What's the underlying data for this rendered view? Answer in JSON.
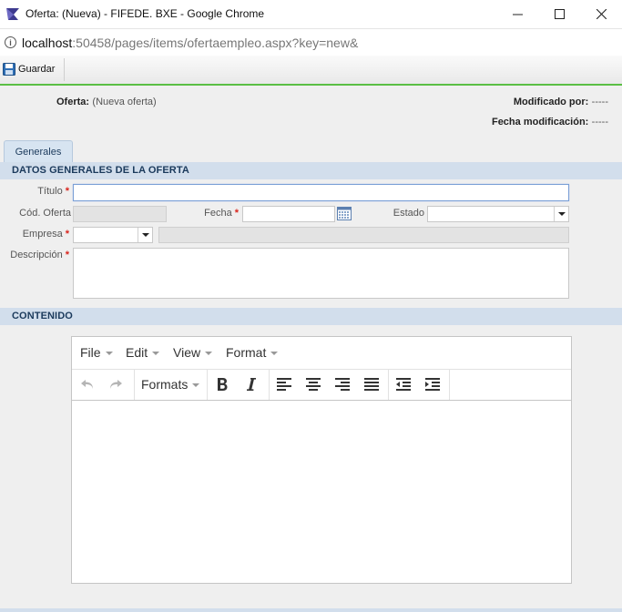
{
  "window": {
    "title": "Oferta: (Nueva) - FIFEDE. BXE - Google Chrome",
    "url_host": "localhost",
    "url_path": ":50458/pages/items/ofertaempleo.aspx?key=new&"
  },
  "toolbar": {
    "save_label": "Guardar"
  },
  "header": {
    "oferta_label": "Oferta:",
    "oferta_value": "(Nueva oferta)",
    "modificado_label": "Modificado por:",
    "modificado_value": "-----",
    "fecha_mod_label": "Fecha modificación:",
    "fecha_mod_value": "-----"
  },
  "tabs": [
    {
      "label": "Generales",
      "active": true
    }
  ],
  "sections": {
    "general": "DATOS GENERALES DE LA OFERTA",
    "content": "CONTENIDO"
  },
  "form": {
    "titulo_label": "Título",
    "cod_label": "Cód. Oferta",
    "fecha_label": "Fecha",
    "estado_label": "Estado",
    "empresa_label": "Empresa",
    "descripcion_label": "Descripción",
    "required_mark": "*"
  },
  "editor": {
    "menus": [
      "File",
      "Edit",
      "View",
      "Format"
    ],
    "formats_label": "Formats",
    "icons": [
      "undo-icon",
      "redo-icon",
      "bold-icon",
      "italic-icon",
      "align-left-icon",
      "align-center-icon",
      "align-right-icon",
      "align-justify-icon",
      "outdent-icon",
      "indent-icon"
    ]
  },
  "colors": {
    "accent_green": "#5bbf45",
    "section_bg": "#d2deec",
    "required_red": "#d9251d"
  }
}
